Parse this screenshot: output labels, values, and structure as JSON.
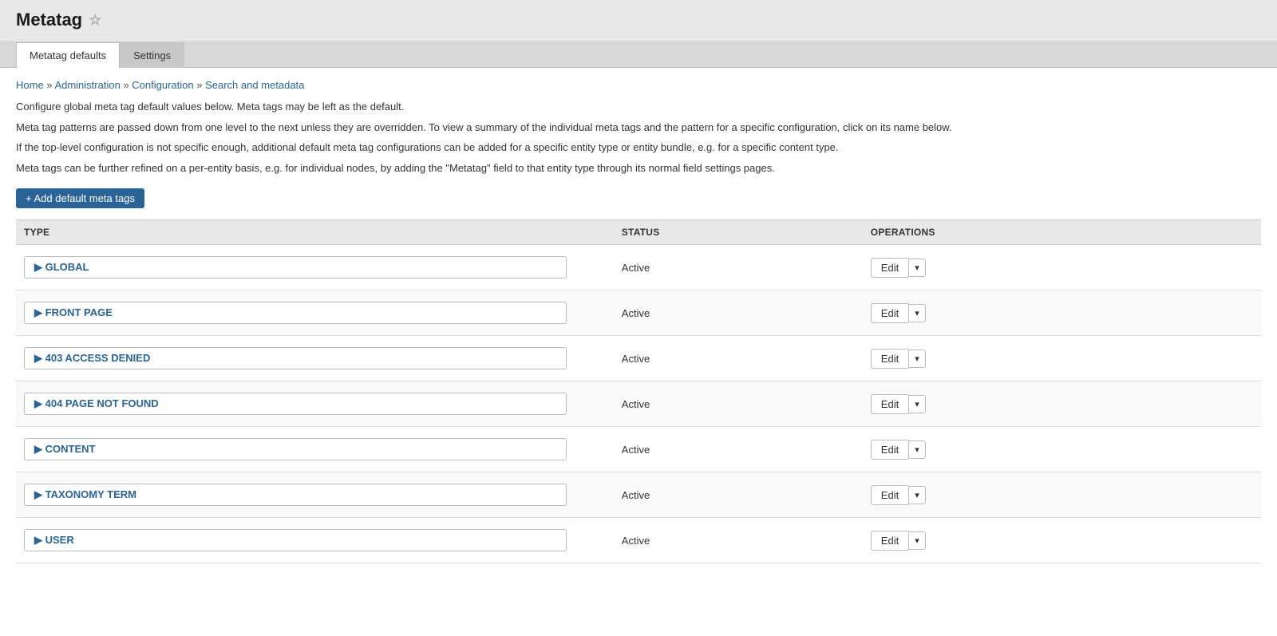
{
  "page": {
    "title": "Metatag",
    "star_icon": "☆"
  },
  "tabs": [
    {
      "id": "metatag-defaults",
      "label": "Metatag defaults",
      "active": true
    },
    {
      "id": "settings",
      "label": "Settings",
      "active": false
    }
  ],
  "breadcrumb": {
    "items": [
      {
        "label": "Home",
        "href": "#"
      },
      {
        "label": "Administration",
        "href": "#"
      },
      {
        "label": "Configuration",
        "href": "#"
      },
      {
        "label": "Search and metadata",
        "href": "#"
      }
    ]
  },
  "descriptions": [
    "Configure global meta tag default values below. Meta tags may be left as the default.",
    "Meta tag patterns are passed down from one level to the next unless they are overridden. To view a summary of the individual meta tags and the pattern for a specific configuration, click on its name below.",
    "If the top-level configuration is not specific enough, additional default meta tag configurations can be added for a specific entity type or entity bundle, e.g. for a specific content type.",
    "Meta tags can be further refined on a per-entity basis, e.g. for individual nodes, by adding the \"Metatag\" field to that entity type through its normal field settings pages."
  ],
  "add_button_label": "+ Add default meta tags",
  "table": {
    "columns": [
      {
        "id": "type",
        "label": "TYPE"
      },
      {
        "id": "status",
        "label": "STATUS"
      },
      {
        "id": "operations",
        "label": "OPERATIONS"
      }
    ],
    "rows": [
      {
        "id": "global",
        "type": "▶ GLOBAL",
        "status": "Active",
        "edit_label": "Edit"
      },
      {
        "id": "front-page",
        "type": "▶ FRONT PAGE",
        "status": "Active",
        "edit_label": "Edit"
      },
      {
        "id": "403-access-denied",
        "type": "▶ 403 ACCESS DENIED",
        "status": "Active",
        "edit_label": "Edit"
      },
      {
        "id": "404-page-not-found",
        "type": "▶ 404 PAGE NOT FOUND",
        "status": "Active",
        "edit_label": "Edit"
      },
      {
        "id": "content",
        "type": "▶ CONTENT",
        "status": "Active",
        "edit_label": "Edit"
      },
      {
        "id": "taxonomy-term",
        "type": "▶ TAXONOMY TERM",
        "status": "Active",
        "edit_label": "Edit"
      },
      {
        "id": "user",
        "type": "▶ USER",
        "status": "Active",
        "edit_label": "Edit"
      }
    ]
  }
}
